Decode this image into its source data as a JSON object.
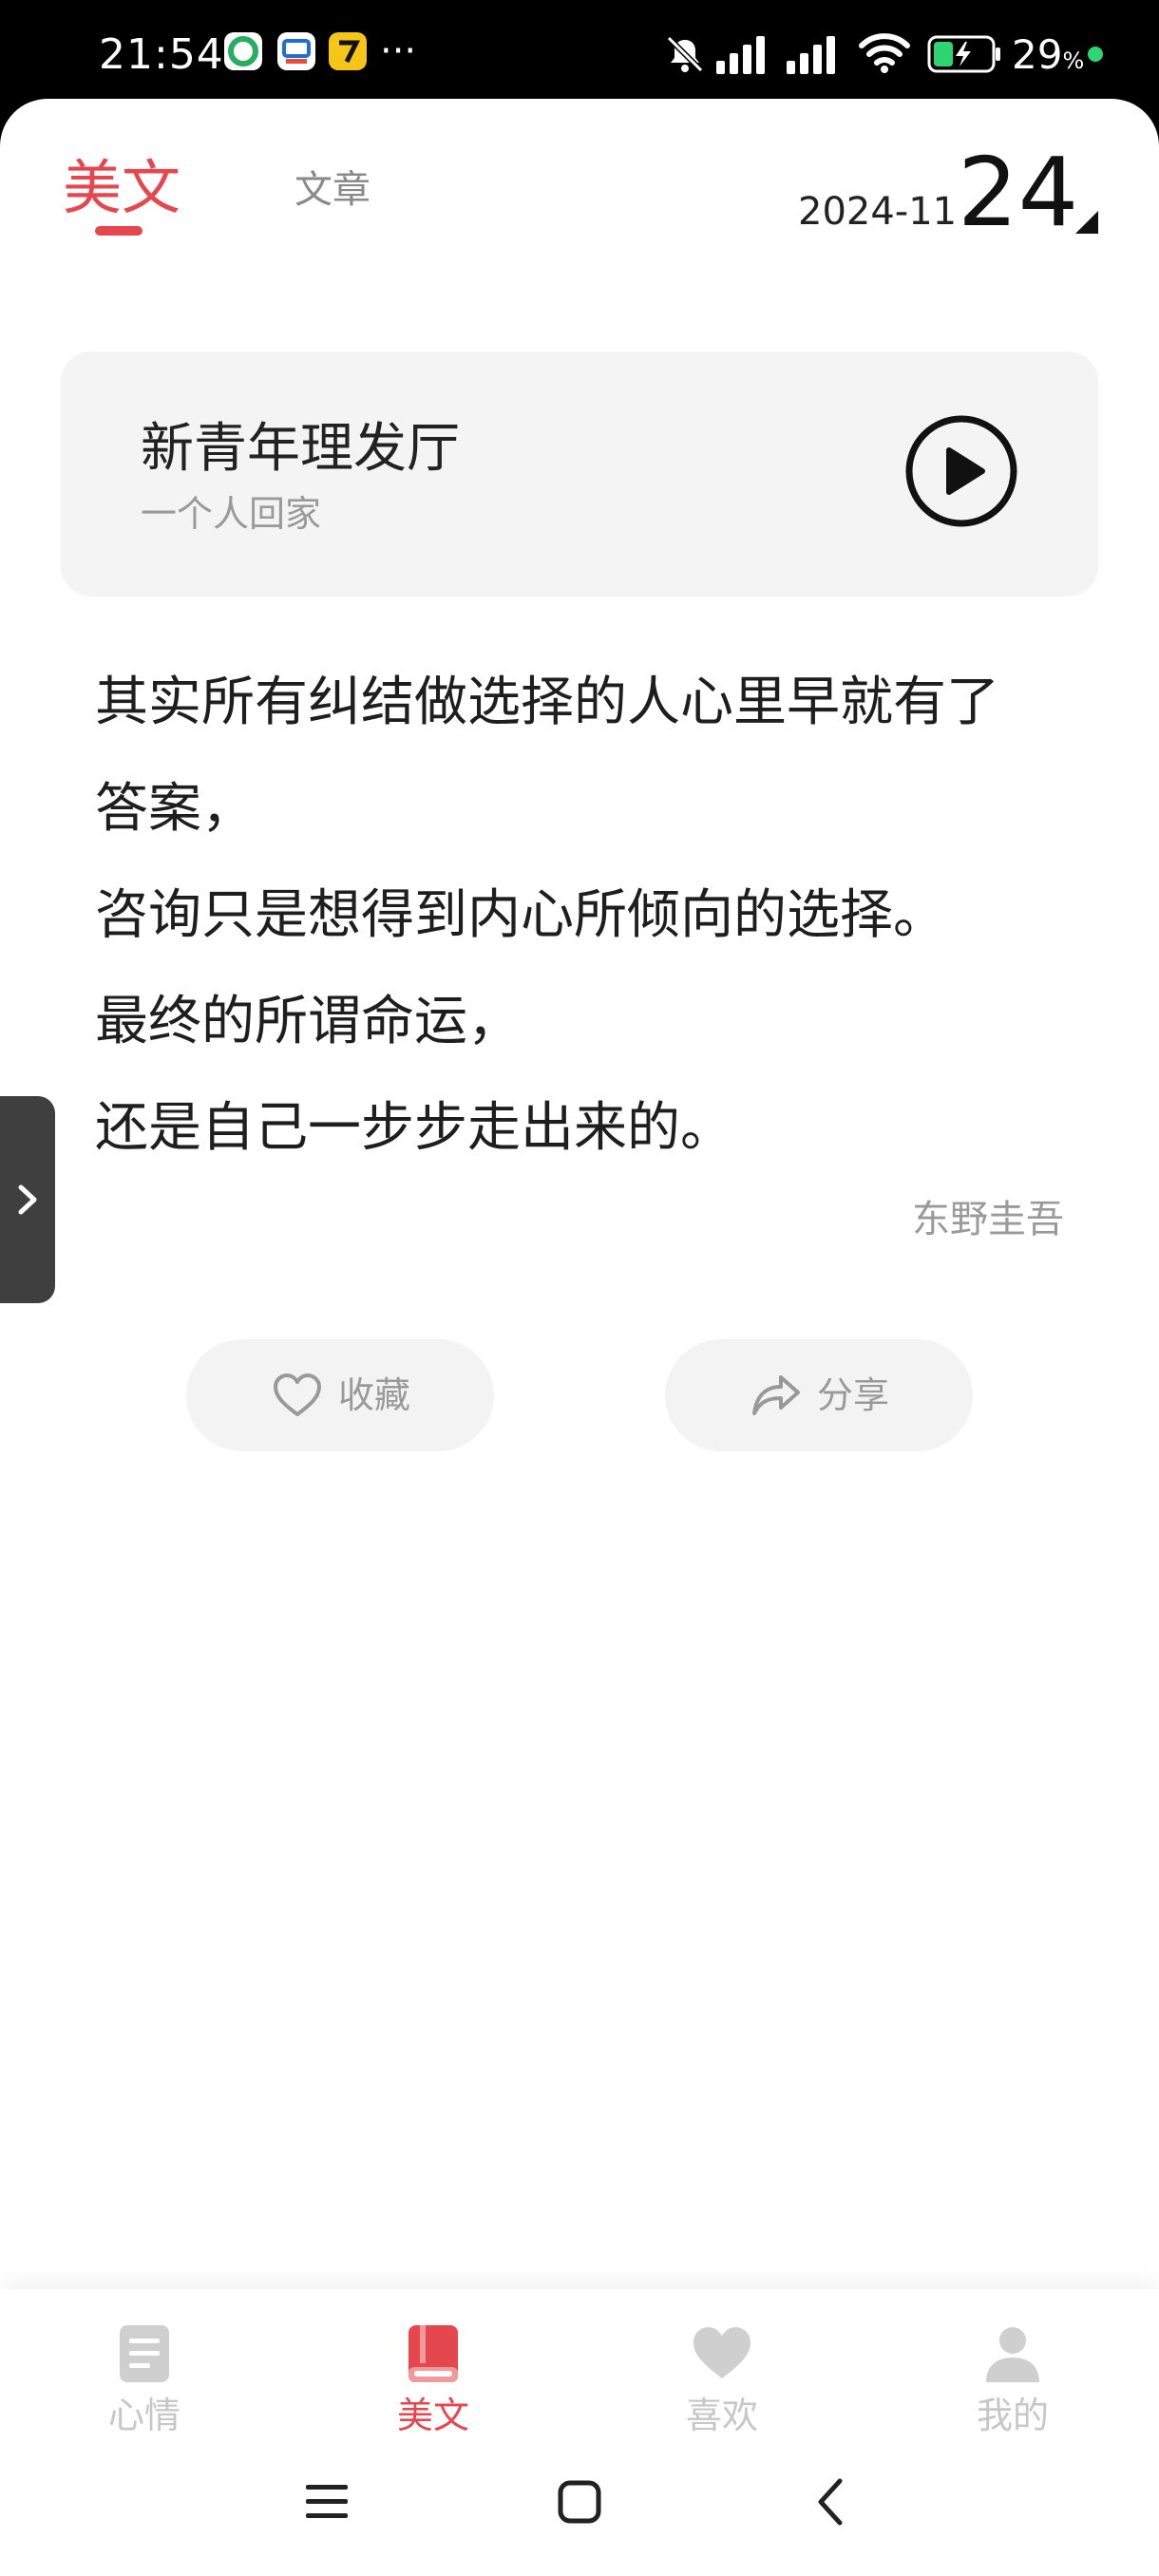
{
  "status_bar": {
    "time": "21:54",
    "more": "···",
    "battery_percent": "29",
    "battery_unit": "%",
    "icons": [
      "app-green-icon",
      "app-blue-icon",
      "app-yellow-icon",
      "mute-icon",
      "signal-icon",
      "signal-icon",
      "wifi-icon",
      "battery-charging-icon"
    ]
  },
  "header": {
    "tab_active": "美文",
    "tab_inactive": "文章",
    "date_year_month": "2024-11",
    "date_day": "24"
  },
  "music": {
    "title": "新青年理发厅",
    "artist": "一个人回家"
  },
  "quote": {
    "lines": [
      "其实所有纠结做选择的人心里早就有了",
      "答案，",
      "咨询只是想得到内心所倾向的选择。",
      "最终的所谓命运，",
      "还是自己一步步走出来的。"
    ],
    "author": "东野圭吾"
  },
  "actions": {
    "favorite": "收藏",
    "share": "分享"
  },
  "bottom_nav": {
    "items": [
      {
        "label": "心情",
        "icon": "note-icon",
        "active": false
      },
      {
        "label": "美文",
        "icon": "book-icon",
        "active": true
      },
      {
        "label": "喜欢",
        "icon": "heart-icon",
        "active": false
      },
      {
        "label": "我的",
        "icon": "person-icon",
        "active": false
      }
    ]
  },
  "colors": {
    "accent": "#e4474d",
    "inactive": "#c7c7c7"
  }
}
